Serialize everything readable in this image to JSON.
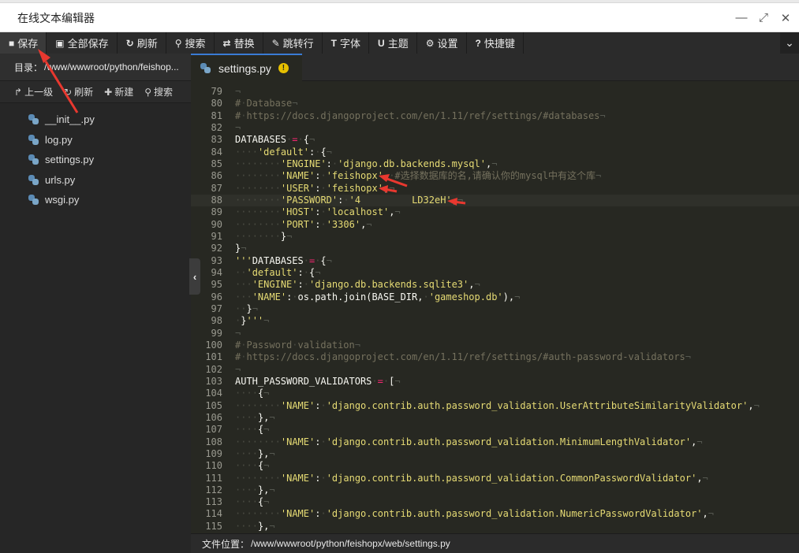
{
  "window": {
    "title": "在线文本编辑器",
    "minimize_glyph": "—",
    "maximize_glyph": "⤢",
    "close_glyph": "✕"
  },
  "toolbar": {
    "items": [
      {
        "label": "保存",
        "icon": "save-icon",
        "glyph": "■"
      },
      {
        "label": "全部保存",
        "icon": "save-all-icon",
        "glyph": "▣"
      },
      {
        "label": "刷新",
        "icon": "refresh-icon",
        "glyph": "↻"
      },
      {
        "label": "搜索",
        "icon": "search-icon",
        "glyph": "⚲"
      },
      {
        "label": "替换",
        "icon": "replace-icon",
        "glyph": "⇄"
      },
      {
        "label": "跳转行",
        "icon": "goto-line-icon",
        "glyph": "✎"
      },
      {
        "label": "字体",
        "icon": "font-icon",
        "glyph": "T"
      },
      {
        "label": "主题",
        "icon": "theme-icon",
        "glyph": "U"
      },
      {
        "label": "设置",
        "icon": "gear-icon",
        "glyph": "⚙"
      },
      {
        "label": "快捷键",
        "icon": "help-icon",
        "glyph": "?"
      }
    ],
    "collapse_glyph": "⌄"
  },
  "sidebar": {
    "dir_label": "目录：",
    "dir_path": "/www/wwwroot/python/feishop...",
    "tools": [
      {
        "label": "上一级",
        "glyph": "↱"
      },
      {
        "label": "刷新",
        "glyph": "↻"
      },
      {
        "label": "新建",
        "glyph": "✚"
      },
      {
        "label": "搜索",
        "glyph": "⚲"
      }
    ],
    "files": [
      "__init__.py",
      "log.py",
      "settings.py",
      "urls.py",
      "wsgi.py"
    ],
    "toggle_glyph": "‹"
  },
  "editor": {
    "tab_label": "settings.py",
    "tab_warning": "!",
    "active_line": 88,
    "lines": [
      {
        "n": "79",
        "t": "¬"
      },
      {
        "n": "80",
        "t": "# Database¬"
      },
      {
        "n": "81",
        "t": "# https://docs.djangoproject.com/en/1.11/ref/settings/#databases¬"
      },
      {
        "n": "82",
        "t": "¬"
      },
      {
        "n": "83",
        "t": "DATABASES = {¬"
      },
      {
        "n": "84",
        "t": "    'default': {¬"
      },
      {
        "n": "85",
        "t": "        'ENGINE': 'django.db.backends.mysql',¬"
      },
      {
        "n": "86",
        "t": "        'NAME': 'feishopx', #选择数据库的名,请确认你的mysql中有这个库¬"
      },
      {
        "n": "87",
        "t": "        'USER': 'feishopx',¬"
      },
      {
        "n": "88",
        "t": "        'PASSWORD': '4         LD32eH',¬"
      },
      {
        "n": "89",
        "t": "        'HOST': 'localhost',¬"
      },
      {
        "n": "90",
        "t": "        'PORT': '3306',¬"
      },
      {
        "n": "91",
        "t": "        }¬"
      },
      {
        "n": "92",
        "t": "}¬"
      },
      {
        "n": "93",
        "t": "'''DATABASES = {¬"
      },
      {
        "n": "94",
        "t": "  'default': {¬"
      },
      {
        "n": "95",
        "t": "   'ENGINE': 'django.db.backends.sqlite3',¬"
      },
      {
        "n": "96",
        "t": "   'NAME': os.path.join(BASE_DIR, 'gameshop.db'),¬"
      },
      {
        "n": "97",
        "t": "  }¬"
      },
      {
        "n": "98",
        "t": " }'''¬"
      },
      {
        "n": "99",
        "t": "¬"
      },
      {
        "n": "100",
        "t": "# Password validation¬"
      },
      {
        "n": "101",
        "t": "# https://docs.djangoproject.com/en/1.11/ref/settings/#auth-password-validators¬"
      },
      {
        "n": "102",
        "t": "¬"
      },
      {
        "n": "103",
        "t": "AUTH_PASSWORD_VALIDATORS = [¬"
      },
      {
        "n": "104",
        "t": "    {¬"
      },
      {
        "n": "105",
        "t": "        'NAME': 'django.contrib.auth.password_validation.UserAttributeSimilarityValidator',¬"
      },
      {
        "n": "106",
        "t": "    },¬"
      },
      {
        "n": "107",
        "t": "    {¬"
      },
      {
        "n": "108",
        "t": "        'NAME': 'django.contrib.auth.password_validation.MinimumLengthValidator',¬"
      },
      {
        "n": "109",
        "t": "    },¬"
      },
      {
        "n": "110",
        "t": "    {¬"
      },
      {
        "n": "111",
        "t": "        'NAME': 'django.contrib.auth.password_validation.CommonPasswordValidator',¬"
      },
      {
        "n": "112",
        "t": "    },¬"
      },
      {
        "n": "113",
        "t": "    {¬"
      },
      {
        "n": "114",
        "t": "        'NAME': 'django.contrib.auth.password_validation.NumericPasswordValidator',¬"
      },
      {
        "n": "115",
        "t": "    },¬"
      }
    ]
  },
  "status": {
    "label": "文件位置：",
    "path": "/www/wwwroot/python/feishopx/web/settings.py"
  },
  "colors": {
    "editor_bg": "#272822",
    "toolbar_bg": "#2b2b2b",
    "sidebar_bg": "#262626",
    "string": "#e6db74",
    "keyword_op": "#f92672",
    "comment": "#75715e",
    "annotation_red": "#e8382f"
  }
}
